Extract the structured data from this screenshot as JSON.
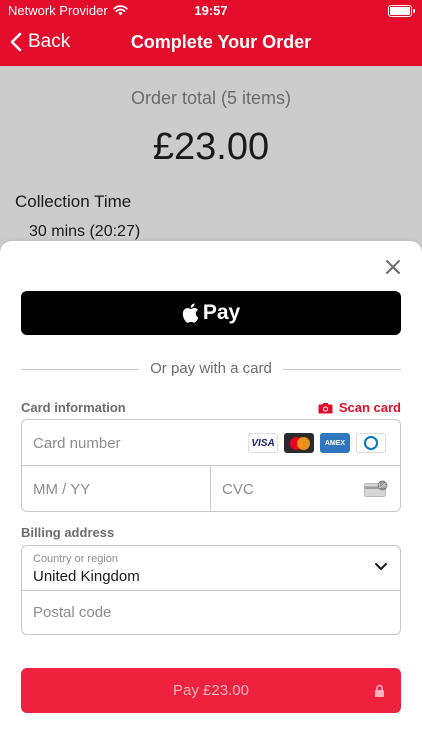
{
  "status_bar": {
    "carrier": "Network Provider",
    "time": "19:57"
  },
  "nav": {
    "back_label": "Back",
    "title": "Complete Your Order"
  },
  "order": {
    "total_label": "Order total (5 items)",
    "total_amount": "£23.00",
    "collection_label": "Collection Time",
    "collection_value": "30 mins (20:27)"
  },
  "sheet": {
    "apple_pay_label": "Pay",
    "divider_text": "Or pay with a card",
    "card_info_label": "Card information",
    "scan_card_label": "Scan card",
    "card_number_placeholder": "Card number",
    "card_brands": [
      "VISA",
      "Mastercard",
      "AMEX",
      "Diners"
    ],
    "expiry_placeholder": "MM / YY",
    "cvc_placeholder": "CVC",
    "cvc_icon_text": "135",
    "billing_label": "Billing address",
    "country_label": "Country or region",
    "country_value": "United Kingdom",
    "postal_placeholder": "Postal code",
    "pay_button_label": "Pay £23.00"
  },
  "colors": {
    "brand_red": "#e30c2a",
    "pay_button": "#ee213e",
    "dim_overlay": "#cccccc"
  },
  "icons": {
    "wifi": "wifi-icon",
    "battery": "battery-icon",
    "back": "chevron-left-icon",
    "close": "close-icon",
    "apple": "apple-icon",
    "camera": "camera-icon",
    "chevron": "chevron-down-icon",
    "lock": "lock-icon"
  }
}
